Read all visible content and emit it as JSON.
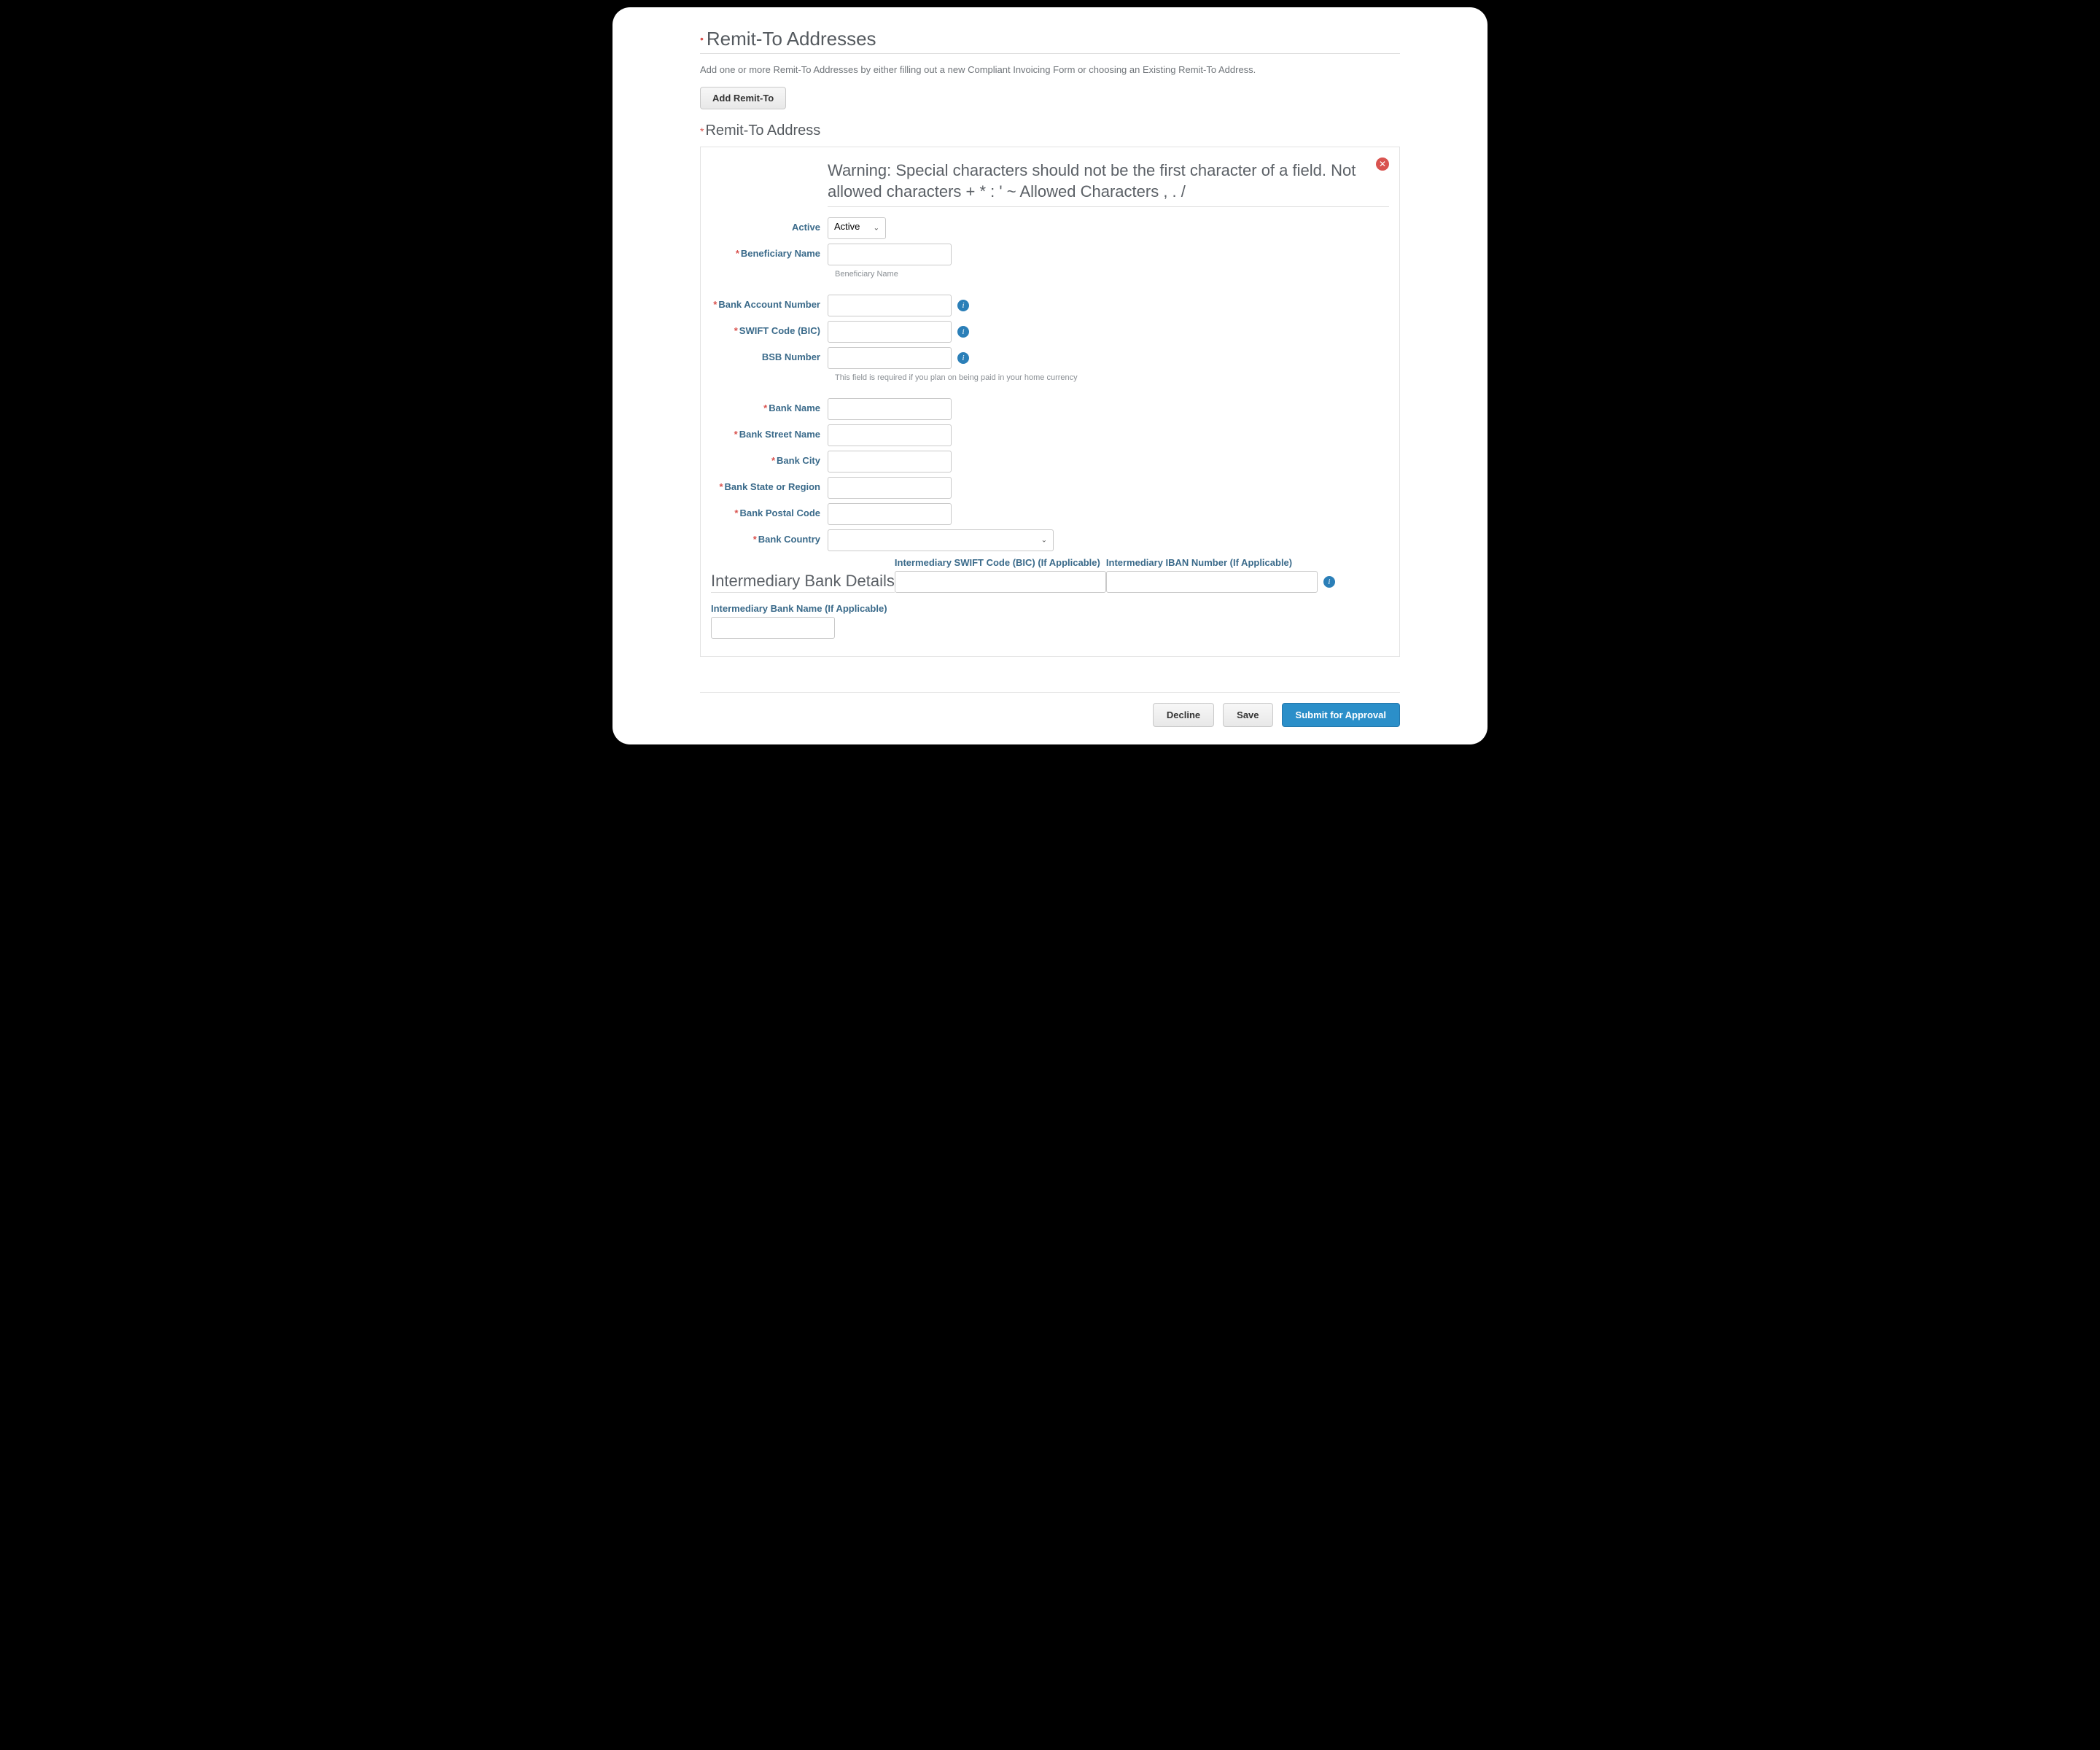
{
  "section": {
    "title": "Remit-To Addresses",
    "description": "Add one or more Remit-To Addresses by either filling out a new Compliant Invoicing Form or choosing an Existing Remit-To Address.",
    "add_button": "Add Remit-To",
    "sub_title": "Remit-To Address"
  },
  "warning": "Warning: Special characters should not be the first character of a field. Not allowed characters + * : ' ~ Allowed Characters , . /",
  "fields": {
    "active": {
      "label": "Active",
      "value": "Active"
    },
    "beneficiary_name": {
      "label": "Beneficiary Name",
      "helper": "Beneficiary Name"
    },
    "bank_account_number": {
      "label": "Bank Account Number"
    },
    "swift_code": {
      "label": "SWIFT Code (BIC)"
    },
    "bsb_number": {
      "label": "BSB Number",
      "helper": "This field is required if you plan on being paid in your home currency"
    },
    "bank_name": {
      "label": "Bank Name"
    },
    "bank_street": {
      "label": "Bank Street Name"
    },
    "bank_city": {
      "label": "Bank City"
    },
    "bank_state": {
      "label": "Bank State or Region"
    },
    "bank_postal": {
      "label": "Bank Postal Code"
    },
    "bank_country": {
      "label": "Bank Country"
    }
  },
  "intermediary": {
    "title": "Intermediary Bank Details",
    "swift_label": "Intermediary SWIFT Code (BIC) (If Applicable)",
    "iban_label": "Intermediary IBAN Number (If Applicable)",
    "bank_name_label": "Intermediary Bank Name (If Applicable)"
  },
  "footer": {
    "decline": "Decline",
    "save": "Save",
    "submit": "Submit for Approval"
  },
  "icons": {
    "info": "i",
    "close": "✕",
    "chevron": "⌄"
  }
}
